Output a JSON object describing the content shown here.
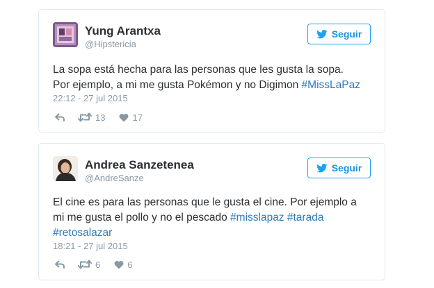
{
  "colors": {
    "link": "#2b7bb9",
    "follow_blue": "#1da1f2",
    "muted": "#8899a6",
    "text": "#292f33"
  },
  "tweets": [
    {
      "author_name": "Yung Arantxa",
      "author_handle": "@Hipstericia",
      "follow_label": "Seguir",
      "follow_icon": "twitter-bird-icon",
      "text_lines": [
        [
          {
            "text": "La sopa está hecha para las personas que les gusta la sopa."
          }
        ],
        [
          {
            "text": "Por ejemplo, a mi me gusta Pokémon y no Digimon "
          },
          {
            "text": "#MissLaPaz",
            "hashtag": true
          }
        ]
      ],
      "timestamp": "22:12 - 27 jul 2015",
      "actions": {
        "reply_icon": "reply-icon",
        "retweet_icon": "retweet-icon",
        "retweets": "13",
        "like_icon": "heart-icon",
        "likes": "17"
      }
    },
    {
      "author_name": "Andrea Sanzetenea",
      "author_handle": "@AndreSanze",
      "follow_label": "Seguir",
      "follow_icon": "twitter-bird-icon",
      "text_lines": [
        [
          {
            "text": "El cine es para las personas que le gusta el cine. Por ejemplo a"
          }
        ],
        [
          {
            "text": "mi me gusta el pollo y no el pescado "
          },
          {
            "text": "#misslapaz",
            "hashtag": true
          },
          {
            "text": " "
          },
          {
            "text": "#tarada",
            "hashtag": true
          }
        ],
        [
          {
            "text": "#retosalazar",
            "hashtag": true
          }
        ]
      ],
      "timestamp": "18:21 - 27 jul 2015",
      "actions": {
        "reply_icon": "reply-icon",
        "retweet_icon": "retweet-icon",
        "retweets": "6",
        "like_icon": "heart-icon",
        "likes": "6"
      }
    }
  ]
}
